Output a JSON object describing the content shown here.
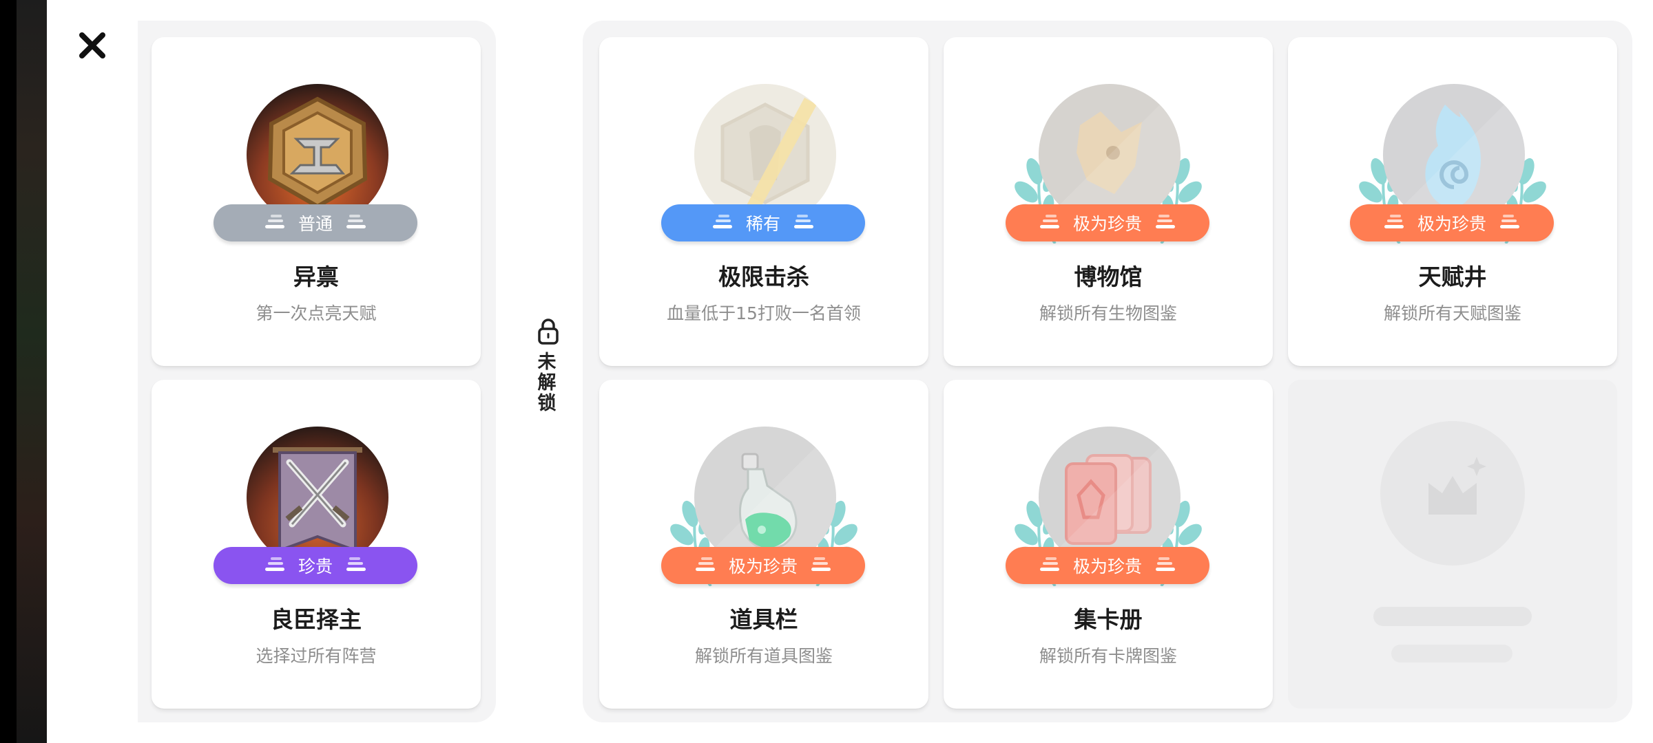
{
  "colors": {
    "common": "#a4acb6",
    "rare": "#5498f7",
    "precious": "#8a54f0",
    "legendary": "#ff7d52",
    "laurel": "#8fd7d4"
  },
  "header": {
    "close_icon": "close-icon"
  },
  "unlocked_achievements": [
    {
      "title": "异禀",
      "description": "第一次点亮天赋",
      "rarity": "普通",
      "tier": "common",
      "icon": "talent-badge-icon"
    },
    {
      "title": "良臣择主",
      "description": "选择过所有阵营",
      "rarity": "珍贵",
      "tier": "precious",
      "icon": "crossed-swords-banner-icon"
    }
  ],
  "locked_section": {
    "label": "未解锁",
    "icon": "lock-icon"
  },
  "locked_achievements": [
    {
      "title": "极限击杀",
      "description": "血量低于15打败一名首领",
      "rarity": "稀有",
      "tier": "rare",
      "icon": "slash-badge-icon",
      "laurels": false
    },
    {
      "title": "博物馆",
      "description": "解锁所有生物图鉴",
      "rarity": "极为珍贵",
      "tier": "legendary",
      "icon": "creature-icon",
      "laurels": true
    },
    {
      "title": "天赋井",
      "description": "解锁所有天赋图鉴",
      "rarity": "极为珍贵",
      "tier": "legendary",
      "icon": "spiral-flame-icon",
      "laurels": true
    },
    {
      "title": "道具栏",
      "description": "解锁所有道具图鉴",
      "rarity": "极为珍贵",
      "tier": "legendary",
      "icon": "potion-icon",
      "laurels": true
    },
    {
      "title": "集卡册",
      "description": "解锁所有卡牌图鉴",
      "rarity": "极为珍贵",
      "tier": "legendary",
      "icon": "cards-icon",
      "laurels": true
    }
  ],
  "hidden_achievement": {
    "icon": "hidden-achievement-icon"
  }
}
